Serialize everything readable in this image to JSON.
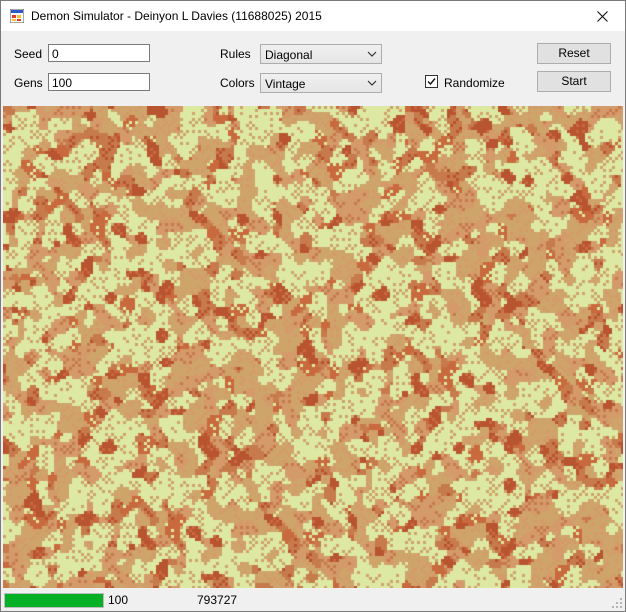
{
  "window": {
    "title": "Demon Simulator - Deinyon L Davies (11688025) 2015",
    "icon": "app-window-icon",
    "close_icon": "close-icon"
  },
  "controls": {
    "seed_label": "Seed",
    "seed_value": "0",
    "gens_label": "Gens",
    "gens_value": "100",
    "rules_label": "Rules",
    "rules_value": "Diagonal",
    "colors_label": "Colors",
    "colors_value": "Vintage",
    "randomize_label": "Randomize",
    "randomize_checked": true,
    "reset_label": "Reset",
    "start_label": "Start"
  },
  "simulation": {
    "palette": [
      "#dde9a3",
      "#cfa46b",
      "#d49a6a",
      "#c77a4c",
      "#b85430",
      "#c9693e"
    ]
  },
  "status": {
    "progress_fraction": 1.0,
    "generation": "100",
    "count": "793727",
    "progress_color": "#06b025"
  }
}
